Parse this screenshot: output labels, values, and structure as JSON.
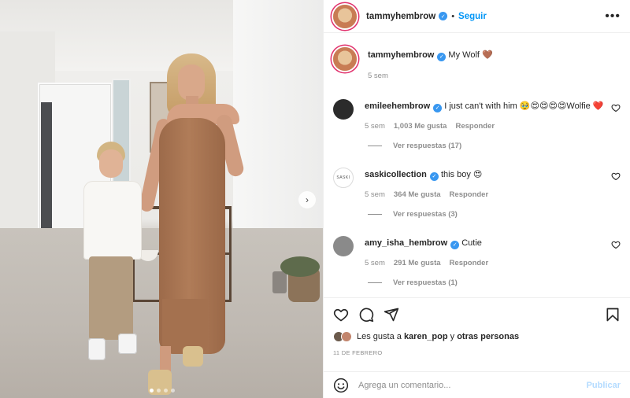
{
  "post": {
    "author": "tammyhembrow",
    "follow_label": "Seguir",
    "separator": "•",
    "more_label": "•••",
    "caption": "My Wolf 🤎",
    "caption_time": "5 sem",
    "next_arrow": "›",
    "carousel_dots": 4,
    "carousel_active": 0
  },
  "comments": [
    {
      "user": "emileehembrow",
      "verified": true,
      "text": "I just can't with him 🥹😍😍😍😍Wolfie ❤️",
      "time": "5 sem",
      "likes": "1,003 Me gusta",
      "reply_label": "Responder",
      "view_replies": "Ver respuestas (17)",
      "avatar_color": "#2b2b2b"
    },
    {
      "user": "saskicollection",
      "verified": true,
      "text": "this boy 😍",
      "time": "5 sem",
      "likes": "364 Me gusta",
      "reply_label": "Responder",
      "view_replies": "Ver respuestas (3)",
      "avatar_text": "SASKI",
      "avatar_color": "#ffffff"
    },
    {
      "user": "amy_isha_hembrow",
      "verified": true,
      "text": "Cutie",
      "time": "5 sem",
      "likes": "291 Me gusta",
      "reply_label": "Responder",
      "view_replies": "Ver respuestas (1)",
      "avatar_color": "#8a8a8a"
    }
  ],
  "actions": {
    "likes_prefix": "Les gusta a",
    "likes_user": "karen_pop",
    "likes_suffix": "y",
    "likes_others": "otras personas",
    "date": "11 de febrero"
  },
  "composer": {
    "placeholder": "Agrega un comentario...",
    "publish_label": "Publicar"
  },
  "colors": {
    "accent": "#0095f6",
    "verified": "#3897f0",
    "muted": "#8e8e8e",
    "heart": "#ed4956"
  }
}
